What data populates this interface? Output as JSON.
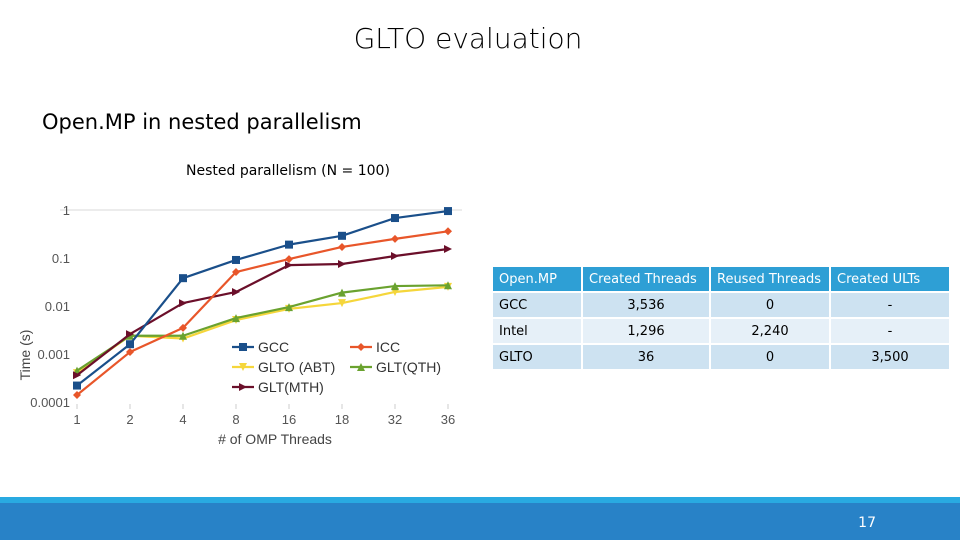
{
  "slide": {
    "title": "GLTO evaluation",
    "subtitle": "Open.MP in nested parallelism",
    "page_number": "17"
  },
  "chart_data": {
    "type": "line",
    "title": "Nested parallelism (N = 100)",
    "xlabel": "# of OMP Threads",
    "ylabel": "Time (s)",
    "yscale": "log",
    "ylim": [
      0.0001,
      1
    ],
    "yticks": [
      "1",
      "0.1",
      "0.01",
      "0.001",
      "0.0001"
    ],
    "ytick_values": [
      1,
      0.1,
      0.01,
      0.001,
      0.0001
    ],
    "categories": [
      "1",
      "2",
      "4",
      "8",
      "16",
      "18",
      "32",
      "36"
    ],
    "grid": "horizontal-top",
    "legend_position": "inside-bottom-right",
    "series": [
      {
        "name": "GCC",
        "color": "#1a4f8a",
        "marker": "square",
        "values": [
          0.00022,
          0.0016,
          0.038,
          0.091,
          0.19,
          0.29,
          0.68,
          0.95
        ]
      },
      {
        "name": "ICC",
        "color": "#e8562a",
        "marker": "diamond",
        "values": [
          0.00014,
          0.0011,
          0.0035,
          0.051,
          0.095,
          0.17,
          0.25,
          0.36
        ]
      },
      {
        "name": "GLTO (ABT)",
        "color": "#f5d63b",
        "marker": "triangle-down",
        "values": [
          0.0004,
          0.0024,
          0.0021,
          0.0051,
          0.0087,
          0.0115,
          0.0196,
          0.025
        ]
      },
      {
        "name": "GLT(QTH)",
        "color": "#6aa22f",
        "marker": "triangle-up",
        "values": [
          0.00045,
          0.0024,
          0.0024,
          0.0056,
          0.0095,
          0.019,
          0.026,
          0.027
        ]
      },
      {
        "name": "GLT(MTH)",
        "color": "#6b0f2a",
        "marker": "triangle-right",
        "values": [
          0.00036,
          0.0026,
          0.0115,
          0.0196,
          0.071,
          0.075,
          0.11,
          0.154
        ]
      }
    ]
  },
  "table": {
    "headers": [
      "Open.MP",
      "Created Threads",
      "Reused Threads",
      "Created ULTs"
    ],
    "rows": [
      [
        "GCC",
        "3,536",
        "0",
        "-"
      ],
      [
        "Intel",
        "1,296",
        "2,240",
        "-"
      ],
      [
        "GLTO",
        "36",
        "0",
        "3,500"
      ]
    ]
  }
}
